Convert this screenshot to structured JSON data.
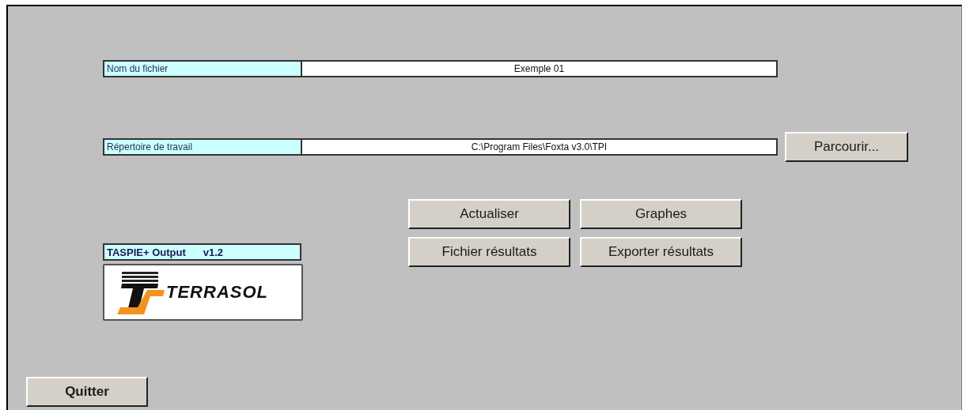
{
  "fields": [
    {
      "label": "Nom du fichier",
      "value": "Exemple 01"
    },
    {
      "label": "Répertoire de travail",
      "value": "C:\\Program Files\\Foxta v3.0\\TPI",
      "button": "Parcourir..."
    }
  ],
  "actions": [
    "Actualiser",
    "Graphes",
    "Fichier résultats",
    "Exporter résultats"
  ],
  "product": {
    "name": "TASPIE+ Output",
    "version": "v1.2"
  },
  "logo": {
    "text": "TERRASOL"
  },
  "quit_button": "Quitter"
}
